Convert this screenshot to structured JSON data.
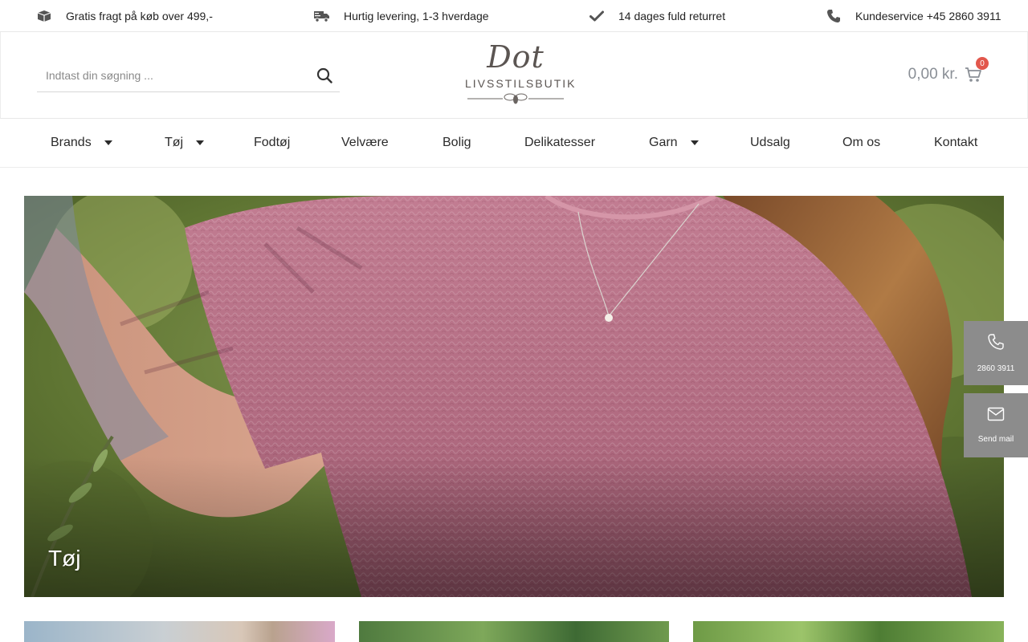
{
  "topbar": {
    "items": [
      {
        "icon": "box-icon",
        "text": "Gratis fragt på køb over 499,-"
      },
      {
        "icon": "truck-icon",
        "text": "Hurtig levering, 1-3 hverdage"
      },
      {
        "icon": "check-icon",
        "text": "14 dages fuld returret"
      },
      {
        "icon": "phone-icon",
        "text": "Kundeservice +45 2860 3911"
      }
    ]
  },
  "header": {
    "search_placeholder": "Indtast din søgning ...",
    "logo_script": "Dot",
    "logo_name": "LIVSSTILSBUTIK",
    "cart_amount": "0,00 kr.",
    "cart_count": "0"
  },
  "nav": {
    "items": [
      {
        "label": "Brands",
        "dropdown": true
      },
      {
        "label": "Tøj",
        "dropdown": true
      },
      {
        "label": "Fodtøj",
        "dropdown": false
      },
      {
        "label": "Velvære",
        "dropdown": false
      },
      {
        "label": "Bolig",
        "dropdown": false
      },
      {
        "label": "Delikatesser",
        "dropdown": false
      },
      {
        "label": "Garn",
        "dropdown": true
      },
      {
        "label": "Udsalg",
        "dropdown": false
      },
      {
        "label": "Om os",
        "dropdown": false
      },
      {
        "label": "Kontakt",
        "dropdown": false
      }
    ]
  },
  "hero": {
    "title": "Tøj"
  },
  "floating": {
    "phone_label": "2860 3911",
    "mail_label": "Send mail"
  },
  "colors": {
    "accent_badge": "#e2574c",
    "float_bg": "#8c8c8c",
    "price_text": "#8a8f96"
  }
}
